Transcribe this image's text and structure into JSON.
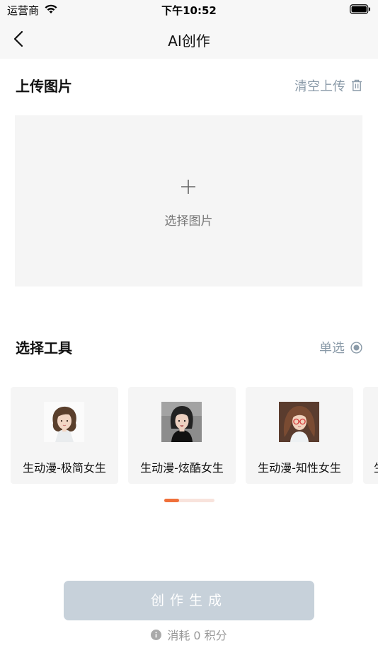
{
  "status_bar": {
    "carrier": "运营商",
    "time": "下午10:52",
    "icons": [
      "wifi-icon",
      "battery-icon"
    ]
  },
  "nav": {
    "title": "AI创作",
    "back_icon": "chevron-left-icon"
  },
  "upload_section": {
    "title": "上传图片",
    "clear_label": "清空上传",
    "clear_icon": "trash-icon",
    "placeholder_label": "选择图片",
    "placeholder_icon": "plus-icon"
  },
  "tools_section": {
    "title": "选择工具",
    "mode_label": "单选",
    "mode_icon": "radio-selected-icon",
    "tools": [
      {
        "label": "生动漫-极简女生",
        "thumb_icon": "anime-girl-minimal-thumbnail"
      },
      {
        "label": "生动漫-炫酷女生",
        "thumb_icon": "anime-girl-cool-thumbnail"
      },
      {
        "label": "生动漫-知性女生",
        "thumb_icon": "anime-girl-intellectual-thumbnail"
      },
      {
        "label": "生",
        "thumb_icon": ""
      }
    ],
    "page_indicator": {
      "current": 1,
      "fraction": 0.3
    }
  },
  "footer": {
    "create_label": "创作生成",
    "info_icon": "info-icon",
    "cost_text": "消耗 0 积分"
  },
  "colors": {
    "accent": "#f0703a",
    "muted_action": "#8a9aa8",
    "disabled_button": "#c7d1da",
    "card_bg": "#f5f5f5"
  }
}
